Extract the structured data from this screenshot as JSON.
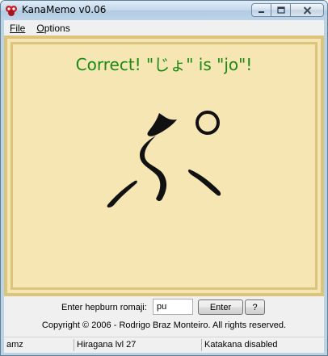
{
  "window": {
    "title": "KanaMemo v0.06",
    "controls": {
      "minimize_icon": "minimize-icon",
      "maximize_icon": "maximize-icon",
      "close_icon": "close-icon"
    }
  },
  "menu": {
    "items": [
      {
        "label": "File",
        "mnemonic": "F"
      },
      {
        "label": "Options",
        "mnemonic": "O"
      }
    ]
  },
  "main": {
    "feedback": "Correct! \"じょ\" is \"jo\"!",
    "feedback_color": "#1a8a12",
    "current_kana": "ぷ",
    "card_border_color": "#dcc57a",
    "card_background_color": "#f5e6b4"
  },
  "input_row": {
    "label": "Enter hepburn romaji:",
    "value": "pu",
    "enter_label": "Enter",
    "help_label": "?"
  },
  "copyright": "Copyright © 2006 - Rodrigo Braz Monteiro. All rights reserved.",
  "status": {
    "user": "amz",
    "hiragana_level": "Hiragana lvl 27",
    "katakana": "Katakana disabled"
  }
}
